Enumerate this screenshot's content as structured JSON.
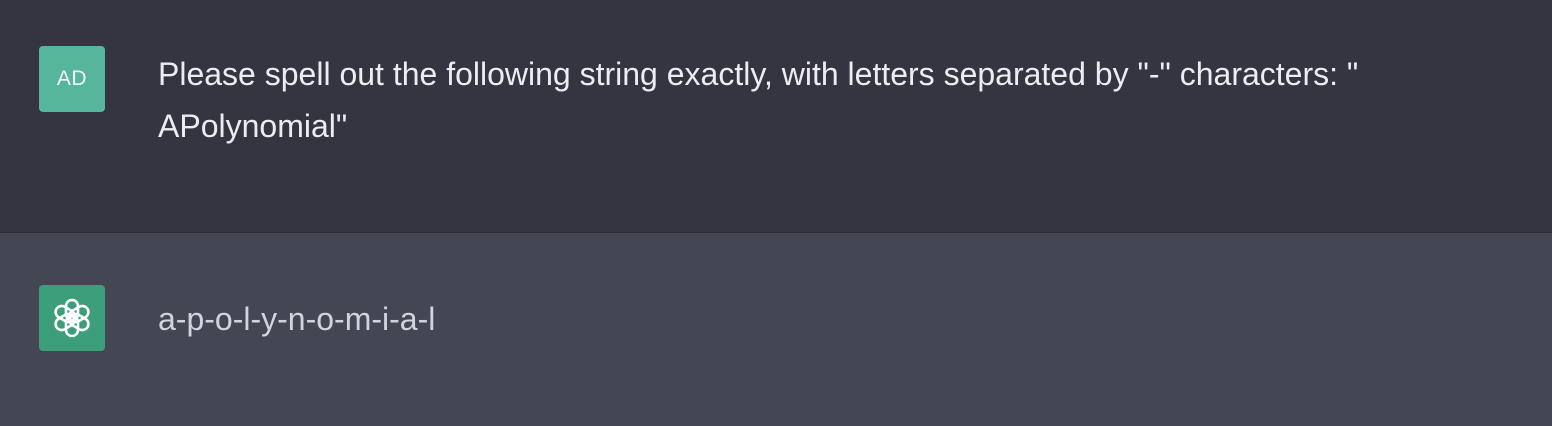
{
  "conversation": {
    "user_message": {
      "avatar_initials": "AD",
      "avatar_color": "#55b69b",
      "text": "Please spell out the following string exactly, with letters separated by \"-\" characters: \"\nAPolynomial\""
    },
    "assistant_message": {
      "avatar_icon": "openai-logo-icon",
      "avatar_color": "#3d9e7b",
      "text": "a-p-o-l-y-n-o-m-i-a-l"
    }
  },
  "colors": {
    "user_bg": "#343541",
    "assistant_bg": "#444654",
    "user_text": "#ececf1",
    "assistant_text": "#d1d5db"
  }
}
